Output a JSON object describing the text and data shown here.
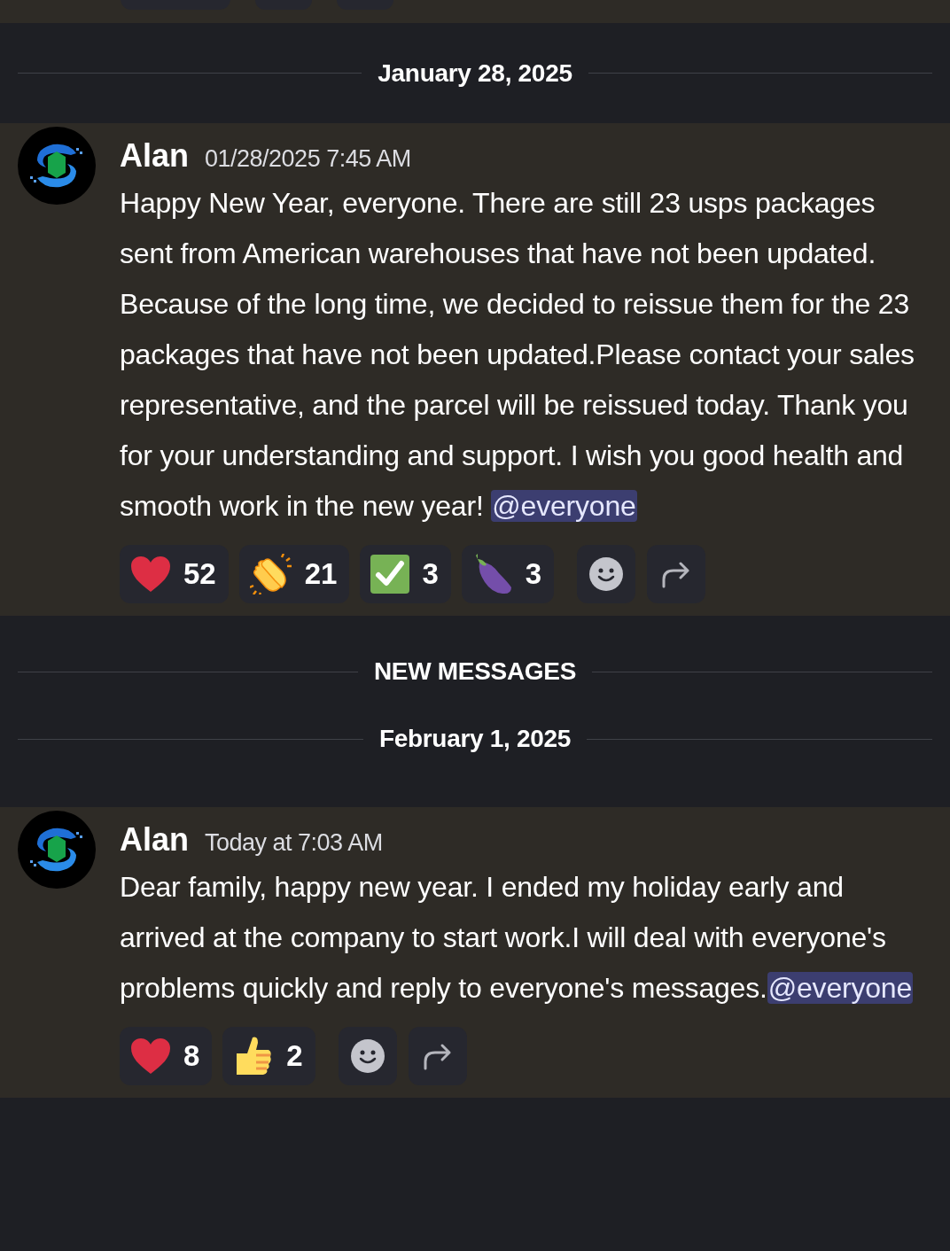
{
  "feed": [
    {
      "kind": "separator",
      "label": "January 28, 2025"
    },
    {
      "kind": "message",
      "author": "Alan",
      "timestamp": "01/28/2025 7:45 AM",
      "body": [
        {
          "kind": "text",
          "text": "Happy New Year, everyone. There are still 23 usps packages sent from American warehouses that have not been updated. Because of the long time, we decided to reissue them for the 23 packages that have not been updated.Please contact your sales representative, and the parcel will be reissued today. Thank you for your understanding and support. I wish you good health and smooth work in the new year! "
        },
        {
          "kind": "mention",
          "text": "@everyone"
        }
      ],
      "reactions": [
        {
          "kind": "heart",
          "count": "52"
        },
        {
          "kind": "clap",
          "count": "21"
        },
        {
          "kind": "check",
          "count": "3"
        },
        {
          "kind": "eggplant",
          "count": "3"
        }
      ]
    },
    {
      "kind": "separator",
      "label": "NEW MESSAGES"
    },
    {
      "kind": "separator",
      "label": "February 1, 2025"
    },
    {
      "kind": "message",
      "author": "Alan",
      "timestamp": "Today at 7:03 AM",
      "body": [
        {
          "kind": "text",
          "text": "Dear family, happy new year. I ended my holiday early and arrived at the company to start work.I will deal with everyone's problems quickly and reply to everyone's messages."
        },
        {
          "kind": "mention",
          "text": "@everyone"
        }
      ],
      "reactions": [
        {
          "kind": "heart",
          "count": "8"
        },
        {
          "kind": "thumbsup",
          "count": "2"
        }
      ]
    }
  ]
}
